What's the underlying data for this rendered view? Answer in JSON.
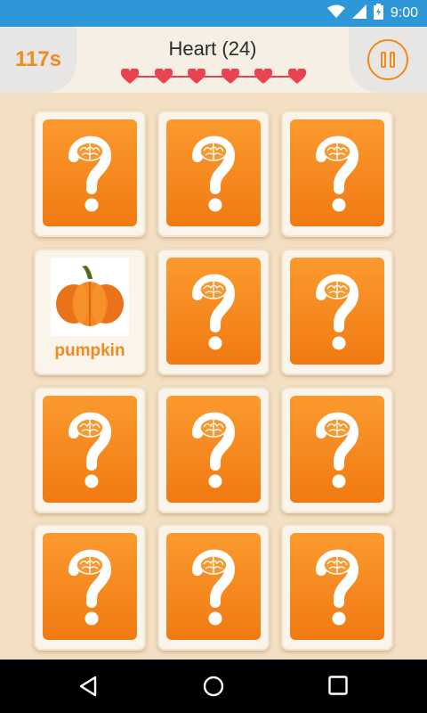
{
  "status_bar": {
    "time": "9:00",
    "icons": [
      "wifi-icon",
      "signal-icon",
      "battery-icon"
    ]
  },
  "header": {
    "timer": "117s",
    "level_title": "Heart (24)",
    "hearts_total": 6,
    "pause_icon": "pause-icon"
  },
  "board": {
    "columns": 3,
    "rows": 4,
    "cards": [
      {
        "state": "hidden"
      },
      {
        "state": "hidden"
      },
      {
        "state": "hidden"
      },
      {
        "state": "revealed",
        "word": "pumpkin",
        "image": "pumpkin-image"
      },
      {
        "state": "hidden"
      },
      {
        "state": "hidden"
      },
      {
        "state": "hidden"
      },
      {
        "state": "hidden"
      },
      {
        "state": "hidden"
      },
      {
        "state": "hidden"
      },
      {
        "state": "hidden"
      },
      {
        "state": "hidden"
      }
    ]
  },
  "nav_bar": {
    "icons": [
      "back-icon",
      "home-icon",
      "recents-icon"
    ]
  },
  "colors": {
    "accent": "#f08a1c",
    "status_bar": "#2e97d7",
    "heart": "#e8434f",
    "background": "#f3dfc1"
  }
}
